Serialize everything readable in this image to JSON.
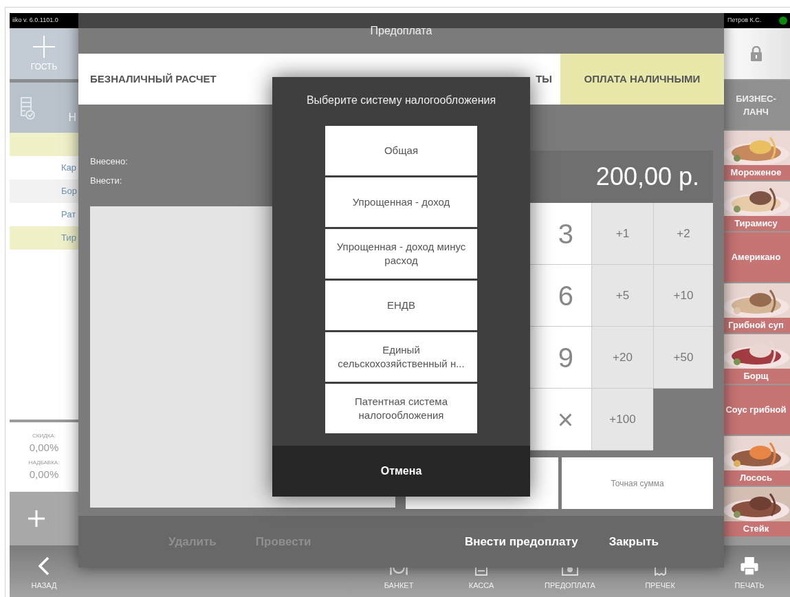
{
  "app": {
    "version": "iiko v. 6.0.1101.0",
    "user": "Петров К.С.",
    "online": true
  },
  "left_panel": {
    "guest_button": "ГОСТЬ",
    "order_tab": "Н",
    "rows": [
      {
        "highlighted": true
      },
      {
        "text": "Кар",
        "highlighted": false
      },
      {
        "text": "Бор",
        "highlighted": false
      },
      {
        "text": "Рат",
        "highlighted": false
      },
      {
        "text": "Тир",
        "highlighted": true
      }
    ],
    "discount_label": "СКИДКА:",
    "discount": "0,00%",
    "markup_label": "НАДБАВКА:",
    "markup": "0,00%"
  },
  "menu": {
    "category": "БИЗНЕС-ЛАНЧ",
    "items": [
      {
        "name": "Мороженое",
        "kind": "picture"
      },
      {
        "name": "Тирамису",
        "kind": "picture"
      },
      {
        "name": "Американо",
        "kind": "plain"
      },
      {
        "name": "Грибной суп",
        "kind": "picture"
      },
      {
        "name": "Борщ",
        "kind": "picture"
      },
      {
        "name": "Соус грибной",
        "kind": "plain"
      },
      {
        "name": "Лосось",
        "kind": "picture"
      },
      {
        "name": "Стейк",
        "kind": "picture"
      }
    ]
  },
  "bottom_bar": [
    {
      "label": "НАЗАД",
      "kind": "back"
    },
    {
      "label": "БАНКЕТ",
      "kind": "banquet"
    },
    {
      "label": "КАССА",
      "kind": "register"
    },
    {
      "label": "ПРЕДОПЛАТА",
      "kind": "prepay"
    },
    {
      "label": "ПРЕЧЕК",
      "kind": "precheck"
    },
    {
      "label": "ПЕЧАТЬ",
      "kind": "print"
    }
  ],
  "prepay_dialog": {
    "title": "Предоплата",
    "tabs": [
      {
        "label": "БЕЗНАЛИЧНЫЙ РАСЧЕТ",
        "selected": false
      },
      {
        "label": "ТЫ",
        "selected": false
      },
      {
        "label": "ОПЛАТА НАЛИЧНЫМИ",
        "selected": true
      }
    ],
    "paid_label": "Внесено:",
    "due_label": "Внести:",
    "amount": "200,00 р.",
    "keypad_rows": [
      [
        {
          "label": "3",
          "kind": "digit"
        },
        {
          "label": "+1",
          "kind": "quick"
        },
        {
          "label": "+2",
          "kind": "quick"
        }
      ],
      [
        {
          "label": "6",
          "kind": "digit"
        },
        {
          "label": "+5",
          "kind": "quick"
        },
        {
          "label": "+10",
          "kind": "quick"
        }
      ],
      [
        {
          "label": "9",
          "kind": "digit"
        },
        {
          "label": "+20",
          "kind": "quick"
        },
        {
          "label": "+50",
          "kind": "quick"
        }
      ],
      [
        {
          "label": "×",
          "kind": "digit"
        },
        {
          "label": "+100",
          "kind": "quick"
        }
      ]
    ],
    "exact_sum": "Точная сумма",
    "actions": [
      {
        "label": "Удалить",
        "disabled": true
      },
      {
        "label": "Провести",
        "disabled": true
      },
      {
        "label": "Внести предоплату",
        "disabled": false
      },
      {
        "label": "Закрыть",
        "disabled": false
      }
    ]
  },
  "tax_dialog": {
    "title": "Выберите систему налогообложения",
    "options": [
      "Общая",
      "Упрощенная - доход",
      "Упрощенная - доход минус расход",
      "ЕНДВ",
      "Единый сельскохозяйственный н...",
      "Патентная система налогообложения"
    ],
    "cancel": "Отмена"
  }
}
